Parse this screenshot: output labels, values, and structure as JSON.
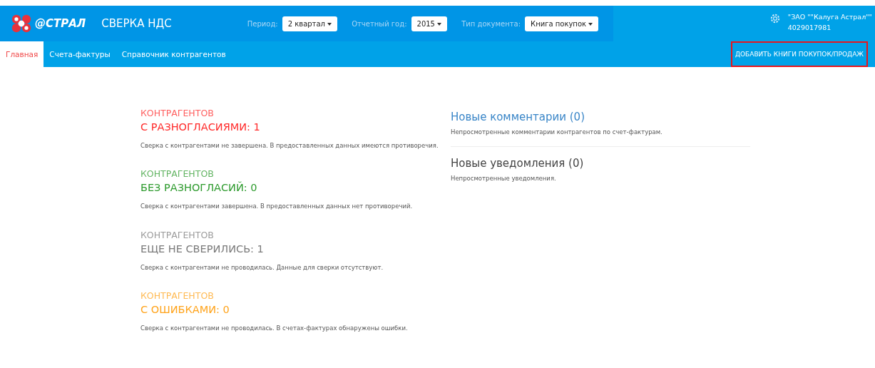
{
  "header": {
    "logo_text": "@СТРАЛ",
    "app_title": "СВЕРКА НДС",
    "filters": [
      {
        "label": "Период:",
        "value": "2 квартал"
      },
      {
        "label": "Отчетный год:",
        "value": "2015"
      },
      {
        "label": "Тип документа:",
        "value": "Книга покупок"
      }
    ],
    "org_name": "\"ЗАО \"\"Калуга Астрал\"\"",
    "org_inn": "4029017981"
  },
  "nav": {
    "tabs": [
      {
        "label": "Главная",
        "selected": true
      },
      {
        "label": "Счета-фактуры",
        "selected": false
      },
      {
        "label": "Справочник контрагентов",
        "selected": false
      }
    ],
    "action": {
      "label": "ДОБАВИТЬ КНИГИ ПОКУПОК/ПРОДАЖ",
      "highlighted": true
    }
  },
  "summary": [
    {
      "overline": "КОНТРАГЕНТОВ",
      "title": "С РАЗНОГЛАСИЯМИ: 1",
      "description": "Сверка с контрагентами не завершена. В предоставленных данных имеются противоречия.",
      "color": "#ff2a2a"
    },
    {
      "overline": "КОНТРАГЕНТОВ",
      "title": "БЕЗ РАЗНОГЛАСИЙ: 0",
      "description": "Сверка с контрагентами завершена. В предоставленных данных нет противоречий.",
      "color": "#2e9b2e"
    },
    {
      "overline": "КОНТРАГЕНТОВ",
      "title": "ЕЩЕ НЕ СВЕРИЛИСЬ: 1",
      "description": "Сверка с контрагентами не проводилась. Данные для сверки отсутствуют.",
      "color": "#7a7a7a"
    },
    {
      "overline": "КОНТРАГЕНТОВ",
      "title": "С ОШИБКАМИ: 0",
      "description": "Сверка с контрагентами не проводилась. В счетах-фактурах обнаружены ошибки.",
      "color": "#ffa31a"
    }
  ],
  "notices": [
    {
      "title": "Новые комментарии (0)",
      "description": "Непросмотренные комментарии контрагентов по счет-фактурам.",
      "color": "#3a86c8"
    },
    {
      "title": "Новые уведомления (0)",
      "description": "Непросмотренные уведомления.",
      "color": "#444444"
    }
  ]
}
